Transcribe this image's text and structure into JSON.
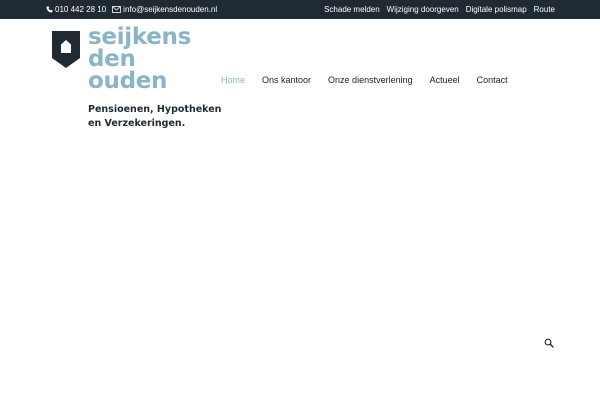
{
  "topbar": {
    "phone": {
      "icon": "phone-icon",
      "text": "010 442 28 10"
    },
    "email": {
      "icon": "envelope-icon",
      "text": "info@seijkensdenouden.nl"
    },
    "links": [
      {
        "label": "Schade melden"
      },
      {
        "label": "Wijziging doorgeven"
      },
      {
        "label": "Digitale polismap"
      },
      {
        "label": "Route"
      }
    ]
  },
  "logo": {
    "icon": "house-shield-icon",
    "word_line1": "seijkens",
    "word_line2": "den",
    "word_line3": "ouden",
    "tagline_line1": "Pensioenen, Hypotheken",
    "tagline_line2": "en Verzekeringen."
  },
  "nav": {
    "items": [
      {
        "label": "Home",
        "active": true
      },
      {
        "label": "Ons kantoor"
      },
      {
        "label": "Onze dienstverlening"
      },
      {
        "label": "Actueel"
      },
      {
        "label": "Contact"
      }
    ]
  },
  "search": {
    "icon": "search-icon"
  },
  "colors": {
    "topbar_bg": "#1f2a33",
    "brand_accent": "#8ab4c8",
    "brand_dark": "#1f2a33",
    "nav_text": "#222222"
  }
}
